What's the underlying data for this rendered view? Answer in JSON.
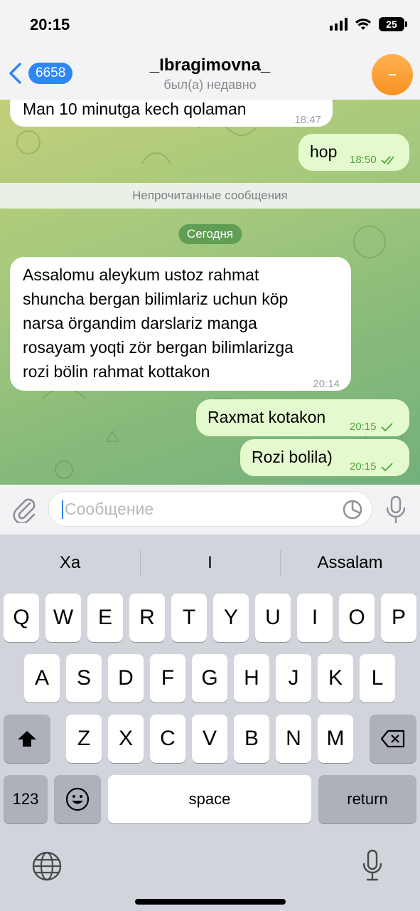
{
  "status": {
    "time": "20:15",
    "battery": "25"
  },
  "header": {
    "back_count": "6658",
    "title": "_Ibragimovna_",
    "subtitle": "был(а) недавно"
  },
  "chat": {
    "messages": [
      {
        "text": "Man 10 minutga kech qolaman",
        "time": "18:47",
        "direction": "incoming"
      },
      {
        "text": "hop",
        "time": "18:50",
        "direction": "outgoing",
        "status": "read"
      },
      {
        "text_lines": [
          "Assalomu aleykum ustoz rahmat",
          "shuncha bergan bilimlariz uchun köp",
          "narsa  örgandim darslariz manga",
          "rosayam yoqti zör bergan bilimlarizga",
          "rozi bölin rahmat kottakon"
        ],
        "time": "20:14",
        "direction": "incoming"
      },
      {
        "text": "Raxmat kotakon",
        "time": "20:15",
        "direction": "outgoing",
        "status": "sent"
      },
      {
        "text": "Rozi bolila)",
        "time": "20:15",
        "direction": "outgoing",
        "status": "sent"
      }
    ],
    "unread_label": "Непрочитанные сообщения",
    "date_label": "Сегодня"
  },
  "input": {
    "placeholder": "Сообщение",
    "value": ""
  },
  "keyboard": {
    "suggestions": [
      "Xa",
      "I",
      "Assalam"
    ],
    "row1": [
      "Q",
      "W",
      "E",
      "R",
      "T",
      "Y",
      "U",
      "I",
      "O",
      "P"
    ],
    "row2": [
      "A",
      "S",
      "D",
      "F",
      "G",
      "H",
      "J",
      "K",
      "L"
    ],
    "row3": [
      "Z",
      "X",
      "C",
      "V",
      "B",
      "N",
      "M"
    ],
    "numbers_label": "123",
    "space_label": "space",
    "return_label": "return"
  },
  "colors": {
    "accent": "#2f86f5",
    "outgoing_bubble": "#e4f9ce",
    "incoming_bubble": "#ffffff",
    "date_pill": "#5f9e53",
    "avatar": "#f7a23a"
  }
}
